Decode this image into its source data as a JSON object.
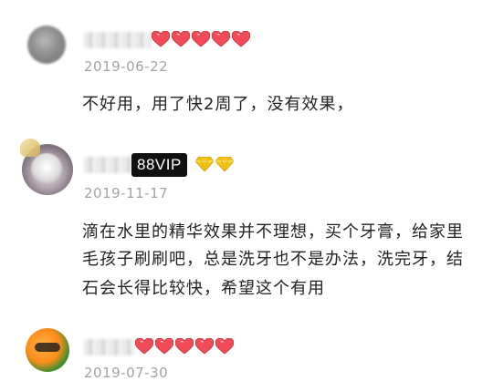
{
  "reviews": [
    {
      "date": "2019-06-22",
      "body": "不好用，用了快2周了，没有效果，",
      "heart_count": 5
    },
    {
      "badge": "88VIP",
      "diamond_count": 2,
      "date": "2019-11-17",
      "body_lines": [
        "滴在水里的精华效果并不理想，买个牙膏，给家里",
        "毛孩子刷刷吧，总是洗牙也不是办法，洗完牙，结",
        "石会长得比较快，希望这个有用"
      ]
    },
    {
      "date": "2019-07-30",
      "heart_count": 5
    }
  ],
  "colors": {
    "heart": "#f04b57",
    "diamond": "#f5c518",
    "date": "#a3a3a3",
    "text": "#222222",
    "badge_bg": "#111111"
  }
}
